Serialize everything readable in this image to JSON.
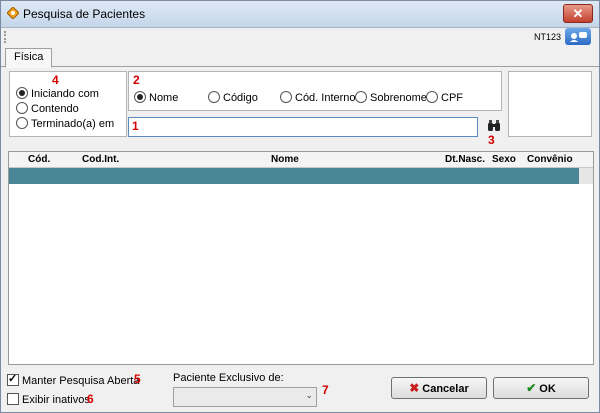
{
  "window": {
    "title": "Pesquisa de Pacientes",
    "close_glyph": "✕"
  },
  "toolbar": {
    "code": "NT123"
  },
  "tabs": [
    {
      "label": "Física"
    }
  ],
  "match_mode": {
    "options": [
      "Iniciando com",
      "Contendo",
      "Terminado(a) em"
    ],
    "selected": "Iniciando com"
  },
  "search_field": {
    "options": [
      "Nome",
      "Código",
      "Cód. Interno",
      "Sobrenome",
      "CPF"
    ],
    "selected": "Nome",
    "value": ""
  },
  "annotations": [
    "1",
    "2",
    "3",
    "4",
    "5",
    "6",
    "7"
  ],
  "grid": {
    "columns": [
      "Cód.",
      "Cod.Int.",
      "Nome",
      "Dt.Nasc.",
      "Sexo",
      "Convênio"
    ],
    "rows": []
  },
  "options": {
    "keep_open": {
      "label": "Manter Pesquisa Aberta",
      "checked": true
    },
    "show_inactive": {
      "label": "Exibir inativos",
      "checked": false
    }
  },
  "exclusive": {
    "label": "Paciente Exclusivo de:",
    "value": "",
    "arrow_glyph": "⌄"
  },
  "buttons": {
    "cancel": "Cancelar",
    "ok": "OK",
    "cancel_glyph": "✖",
    "ok_glyph": "✔"
  },
  "colors": {
    "selected_row": "#4a8796",
    "annotation": "#d40000"
  }
}
